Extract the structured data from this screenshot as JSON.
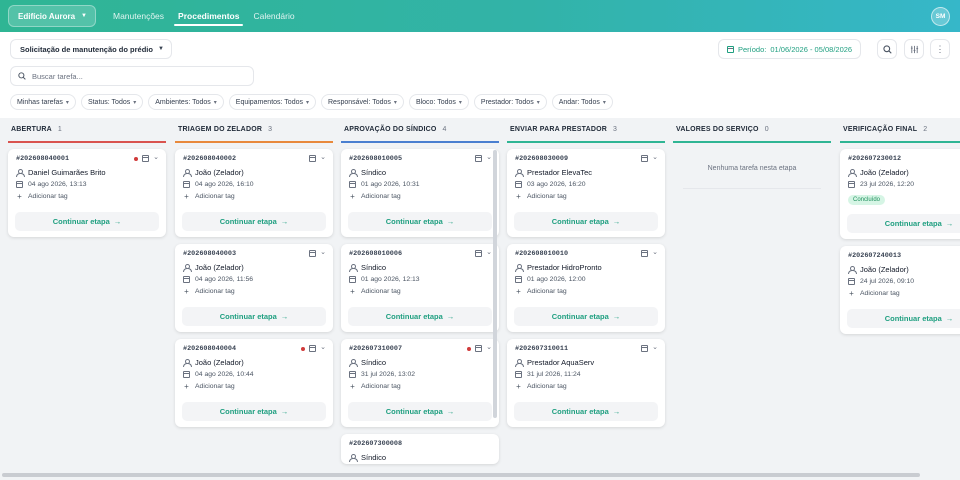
{
  "nav": {
    "building": "Edifício Aurora",
    "links": [
      "Manutenções",
      "Procedimentos",
      "Calendário"
    ],
    "active": 1,
    "avatar": "SM"
  },
  "toolbar": {
    "procedure": "Solicitação de manutenção do prédio",
    "period_label": "Período:",
    "period_value": "01/06/2026 - 05/08/2026",
    "search_placeholder": "Buscar tarefa...",
    "filters": [
      "Minhas tarefas",
      "Status: Todos",
      "Ambientes: Todos",
      "Equipamentos: Todos",
      "Responsável: Todos",
      "Bloco: Todos",
      "Prestador: Todos",
      "Andar: Todos"
    ]
  },
  "columns": [
    {
      "title": "ABERTURA",
      "count": "1",
      "color": "#d9534f",
      "cards": [
        {
          "id": "#202608040001",
          "dot": true,
          "person": "Daniel Guimarães Brito",
          "date": "04 ago 2026, 13:13"
        }
      ]
    },
    {
      "title": "TRIAGEM DO ZELADOR",
      "count": "3",
      "color": "#e8893c",
      "cards": [
        {
          "id": "#202608040002",
          "dot": false,
          "person": "João (Zelador)",
          "date": "04 ago 2026, 16:10"
        },
        {
          "id": "#202608040003",
          "dot": false,
          "person": "João (Zelador)",
          "date": "04 ago 2026, 11:56"
        },
        {
          "id": "#202608040004",
          "dot": true,
          "person": "João (Zelador)",
          "date": "04 ago 2026, 10:44"
        }
      ]
    },
    {
      "title": "APROVAÇÃO DO SÍNDICO",
      "count": "4",
      "color": "#4a7fd0",
      "cards": [
        {
          "id": "#202608010005",
          "dot": false,
          "person": "Síndico",
          "date": "01 ago 2026, 10:31"
        },
        {
          "id": "#202608010006",
          "dot": false,
          "person": "Síndico",
          "date": "01 ago 2026, 12:13"
        },
        {
          "id": "#202607310007",
          "dot": true,
          "person": "Síndico",
          "date": "31 jul 2026, 13:02"
        },
        {
          "id": "#202607300008",
          "dot": false,
          "person": "Síndico",
          "date": "",
          "partial": true
        }
      ]
    },
    {
      "title": "ENVIAR PARA PRESTADOR",
      "count": "3",
      "color": "#2fb594",
      "cards": [
        {
          "id": "#202608030009",
          "dot": false,
          "person": "Prestador ElevaTec",
          "date": "03 ago 2026, 16:20"
        },
        {
          "id": "#202608010010",
          "dot": false,
          "person": "Prestador HidroPronto",
          "date": "01 ago 2026, 12:00"
        },
        {
          "id": "#202607310011",
          "dot": false,
          "person": "Prestador AquaServ",
          "date": "31 jul 2026, 11:24"
        }
      ]
    },
    {
      "title": "VALORES DO SERVIÇO",
      "count": "0",
      "color": "#2fb594",
      "empty": "Nenhuma tarefa nesta etapa",
      "cards": []
    },
    {
      "title": "VERIFICAÇÃO FINAL",
      "count": "2",
      "color": "#2fb594",
      "cards": [
        {
          "id": "#202607230012",
          "dot": false,
          "person": "João (Zelador)",
          "date": "23 jul 2026, 12:20",
          "badge": "Concluído"
        },
        {
          "id": "#202607240013",
          "dot": false,
          "person": "João (Zelador)",
          "date": "24 jul 2026, 09:10"
        }
      ]
    }
  ],
  "card_labels": {
    "add_tag": "Adicionar tag",
    "continue": "Continuar etapa"
  }
}
